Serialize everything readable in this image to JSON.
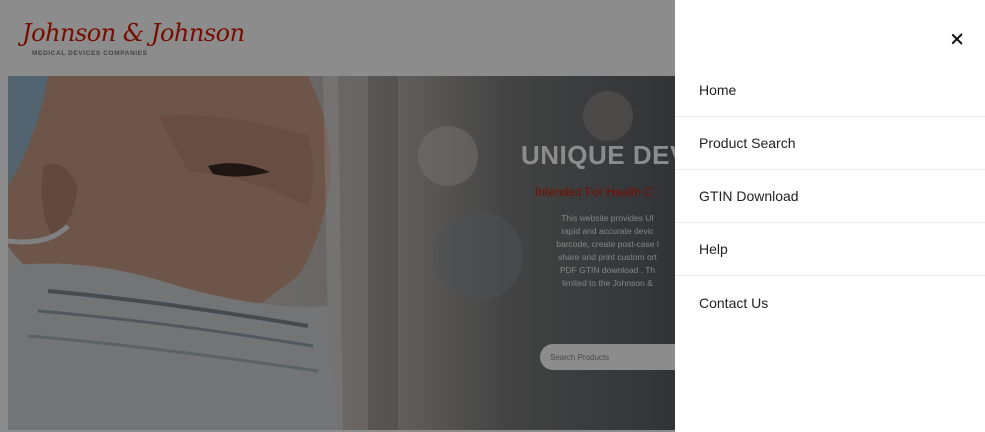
{
  "header": {
    "logo_text": "Johnson & Johnson",
    "logo_subtitle": "MEDICAL DEVICES COMPANIES"
  },
  "hero": {
    "title": "UNIQUE DEV",
    "subtitle": "Intended For Health C",
    "description_lines": [
      "This website provides UI",
      "rapid and accurate devic",
      "barcode, create post-case l",
      "share and print custom ort",
      "PDF GTIN download . Th",
      "limited to the Johnson &"
    ],
    "search_placeholder": "Search Products"
  },
  "menu": {
    "close_icon": "close-icon",
    "items": [
      {
        "label": "Home"
      },
      {
        "label": "Product Search"
      },
      {
        "label": "GTIN Download"
      },
      {
        "label": "Help"
      },
      {
        "label": "Contact Us"
      }
    ]
  },
  "colors": {
    "brand_red": "#d51900",
    "overlay": "rgba(0,0,0,0.45)",
    "menu_bg": "#ffffff",
    "menu_text": "#222222"
  }
}
